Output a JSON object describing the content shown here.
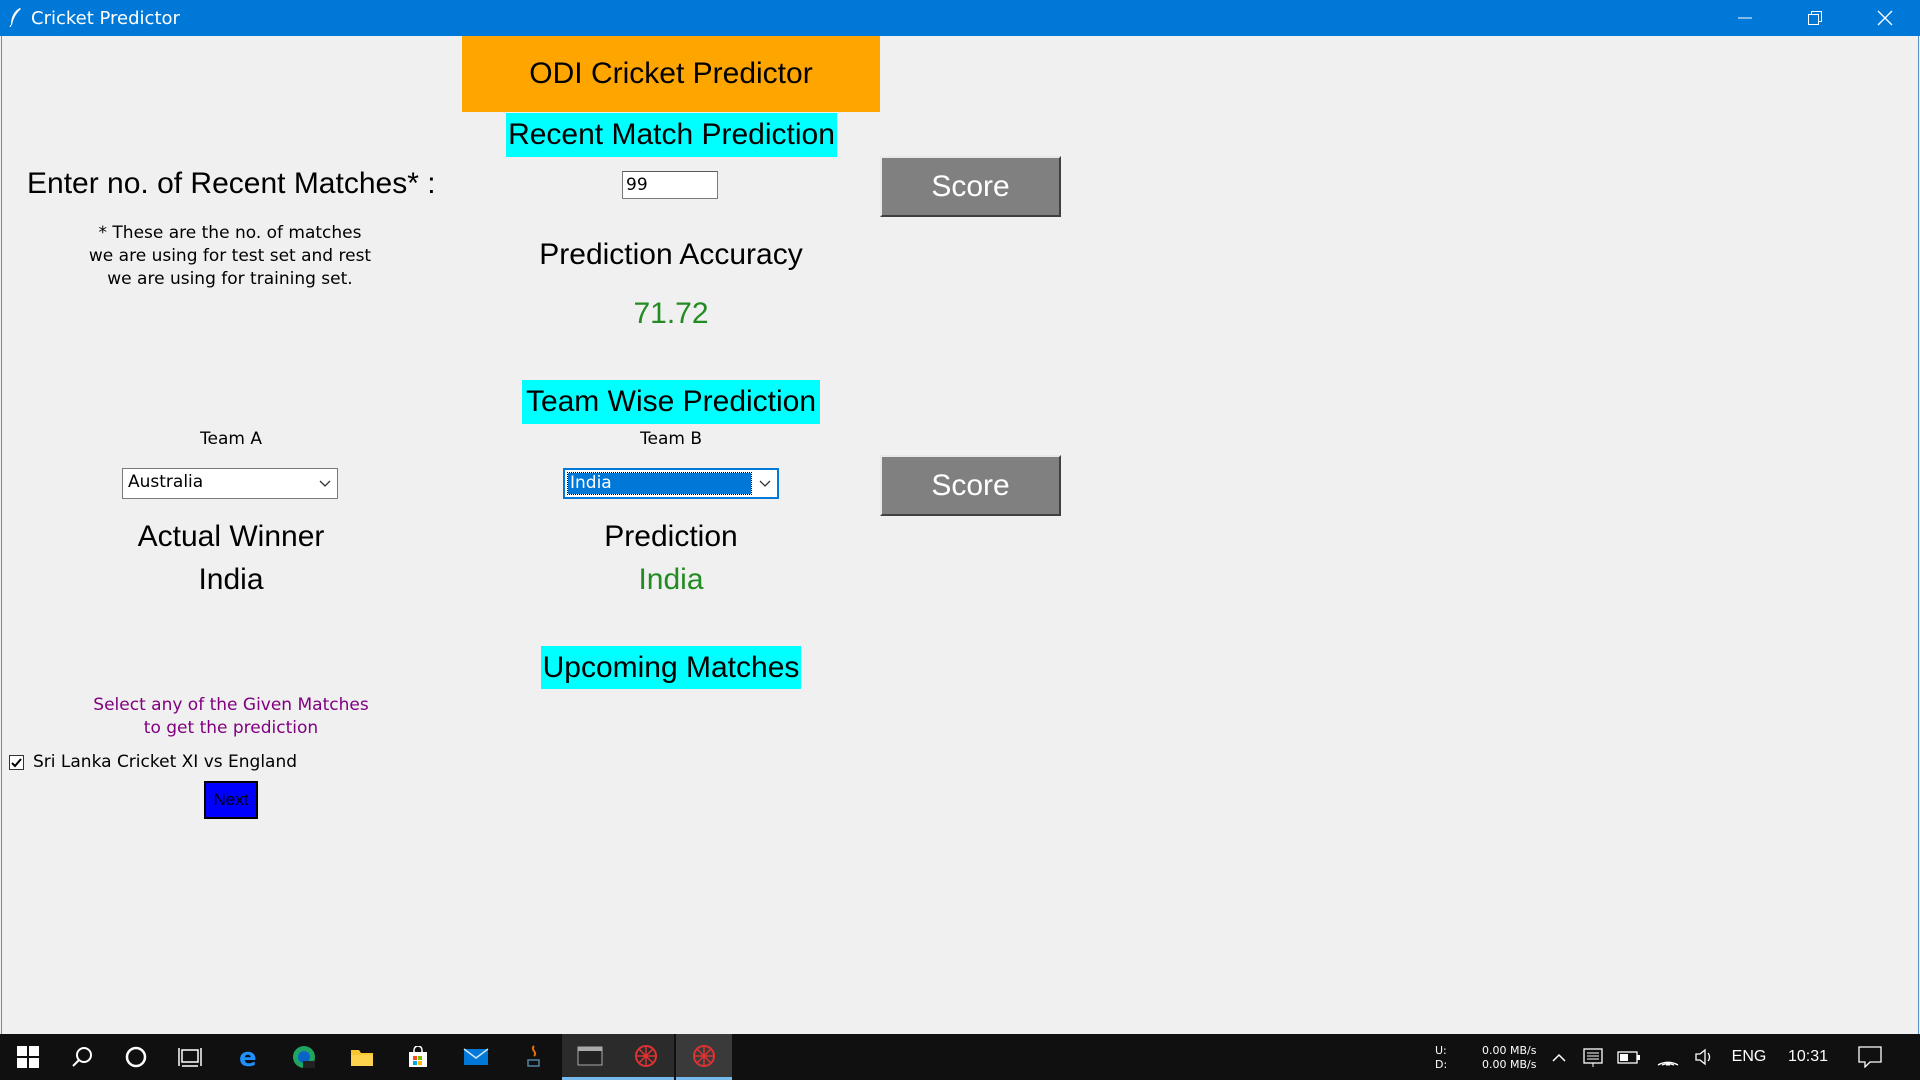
{
  "window": {
    "title": "Cricket Predictor"
  },
  "header": {
    "title": "ODI Cricket Predictor"
  },
  "recent": {
    "section_title": "Recent Match Prediction",
    "input_label": "Enter no. of Recent Matches* :",
    "input_value": "99",
    "note_line1": "* These are the no. of matches",
    "note_line2": "we are using for test set and rest",
    "note_line3": "we are using for training set.",
    "score_label": "Score",
    "accuracy_label": "Prediction Accuracy",
    "accuracy_value": "71.72"
  },
  "team_wise": {
    "section_title": "Team Wise Prediction",
    "team_a_label": "Team A",
    "team_b_label": "Team B",
    "team_a_value": "Australia",
    "team_b_value": "India",
    "score_label": "Score",
    "actual_winner_label": "Actual Winner",
    "actual_winner_value": "India",
    "prediction_label": "Prediction",
    "prediction_value": "India"
  },
  "upcoming": {
    "section_title": "Upcoming Matches",
    "instruction_line1": "Select any of the Given Matches",
    "instruction_line2": "to get the prediction",
    "match_label": "Sri Lanka Cricket XI vs England",
    "match_checked": true,
    "next_label": "Next"
  },
  "taskbar": {
    "upload_label": "U:",
    "download_label": "D:",
    "upload_speed": "0.00 MB/s",
    "download_speed": "0.00 MB/s",
    "language": "ENG",
    "time": "10:31"
  },
  "colors": {
    "titlebar": "#0078d7",
    "heading_orange": "#ffa500",
    "heading_cyan": "#00ffff",
    "result_green": "#228b22",
    "score_button": "#808080",
    "instruction_purple": "#800080",
    "next_button": "#0000ff"
  }
}
